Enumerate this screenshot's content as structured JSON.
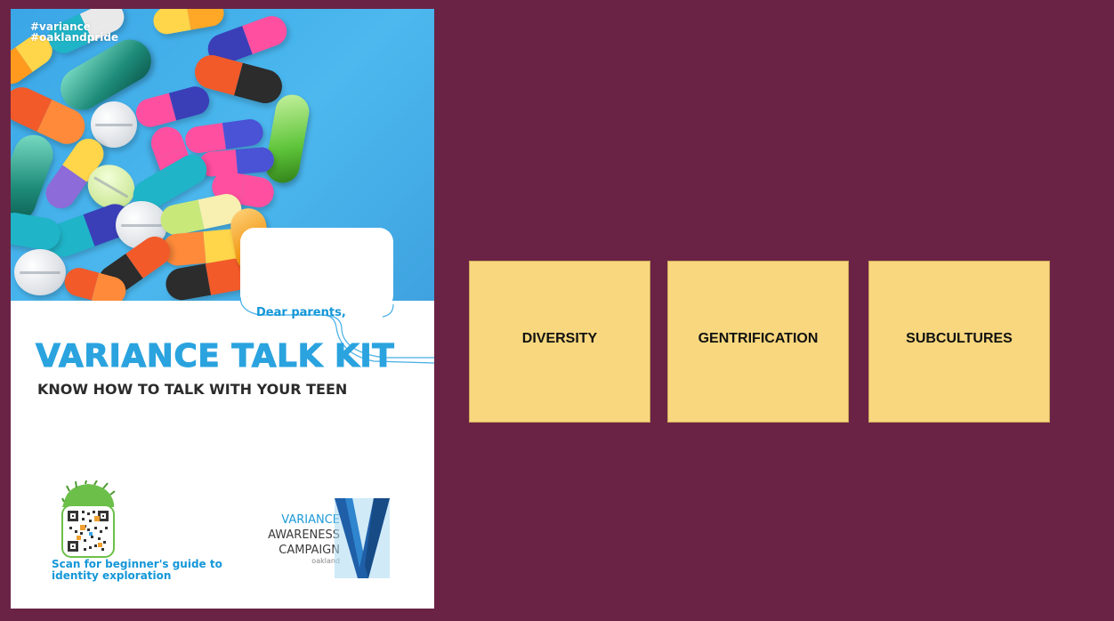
{
  "poster": {
    "hashtags": [
      "#variance",
      "#oaklandpride"
    ],
    "greeting": "Dear parents,",
    "title": "VARIANCE TALK KIT",
    "subtitle": "KNOW HOW TO TALK WITH YOUR TEEN",
    "scan_text": [
      "Scan for beginner's guide to",
      "identity exploration"
    ],
    "logo": {
      "line1": "VARIANCE",
      "line2": "AWARENESS",
      "line3": "CAMPAIGN",
      "line4": "oakland",
      "letter": "V"
    }
  },
  "cards": [
    {
      "label": "DIVERSITY"
    },
    {
      "label": "GENTRIFICATION"
    },
    {
      "label": "SUBCULTURES"
    }
  ],
  "colors": {
    "background": "#6a2345",
    "card": "#f8d77e",
    "accent_blue": "#2aa3df"
  },
  "icons": [
    "qr-code-icon",
    "variance-v-logo-icon"
  ]
}
